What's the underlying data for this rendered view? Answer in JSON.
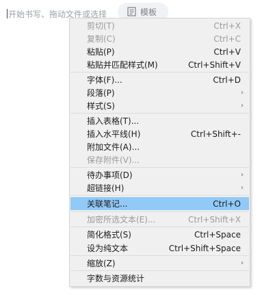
{
  "editor": {
    "placeholder": "开始书写、拖动文件或选择",
    "template_label": "模板"
  },
  "menu": {
    "items": [
      {
        "label": "剪切(T)",
        "shortcut": "Ctrl+X",
        "disabled": true
      },
      {
        "label": "复制(C)",
        "shortcut": "Ctrl+C",
        "disabled": true
      },
      {
        "label": "粘贴(P)",
        "shortcut": "Ctrl+V"
      },
      {
        "label": "粘贴并匹配样式(M)",
        "shortcut": "Ctrl+Shift+V"
      },
      {
        "label": "字体(F)...",
        "shortcut": "Ctrl+D"
      },
      {
        "label": "段落(P)",
        "submenu": true
      },
      {
        "label": "样式(S)",
        "submenu": true
      },
      {
        "label": "插入表格(T)...",
        "shortcut": ""
      },
      {
        "label": "插入水平线(H)",
        "shortcut": "Ctrl+Shift+-"
      },
      {
        "label": "附加文件(A)...",
        "shortcut": ""
      },
      {
        "label": "保存附件(V)...",
        "shortcut": "",
        "disabled": true
      },
      {
        "label": "待办事项(D)",
        "submenu": true
      },
      {
        "label": "超链接(H)",
        "submenu": true
      },
      {
        "label": "关联笔记...",
        "shortcut": "Ctrl+O",
        "highlighted": true
      },
      {
        "label": "加密所选文本(E)...",
        "shortcut": "Ctrl+Shift+X",
        "disabled": true
      },
      {
        "label": "简化格式(S)",
        "shortcut": "Ctrl+Space"
      },
      {
        "label": "设为纯文本",
        "shortcut": "Ctrl+Shift+Space"
      },
      {
        "label": "缩放(Z)",
        "submenu": true
      },
      {
        "label": "字数与资源统计",
        "shortcut": ""
      }
    ],
    "submenu_arrow": "›"
  },
  "colors": {
    "highlight": "#91c9f7",
    "disabled_text": "#9a9a9a"
  }
}
